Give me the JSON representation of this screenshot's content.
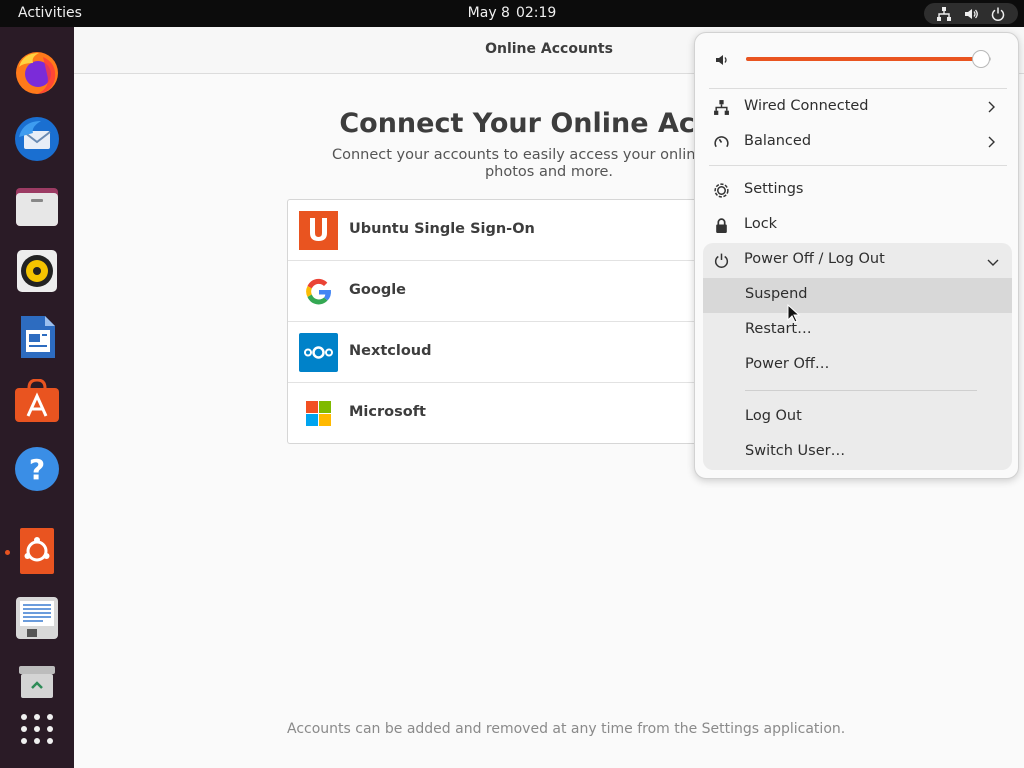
{
  "topbar": {
    "activities": "Activities",
    "date": "May 8",
    "time": "02:19",
    "status_icons": [
      "network-wired-icon",
      "volume-icon",
      "power-icon"
    ]
  },
  "dock": {
    "items": [
      {
        "name": "firefox-icon"
      },
      {
        "name": "thunderbird-icon"
      },
      {
        "name": "files-icon"
      },
      {
        "name": "rhythmbox-icon"
      },
      {
        "name": "libreoffice-writer-icon"
      },
      {
        "name": "ubuntu-software-icon"
      },
      {
        "name": "help-icon"
      },
      {
        "name": "ubuntu-installer-icon",
        "running": true
      },
      {
        "name": "text-editor-icon"
      },
      {
        "name": "trash-icon"
      },
      {
        "name": "show-applications-icon"
      }
    ]
  },
  "window": {
    "title": "Online Accounts",
    "heading": "Connect Your Online Accou",
    "subtitle_line1": "Connect your accounts to easily access your online calenda",
    "subtitle_line2": "photos and more.",
    "providers": [
      {
        "name": "Ubuntu Single Sign-On",
        "icon": "ubuntu-sso-icon"
      },
      {
        "name": "Google",
        "icon": "google-icon"
      },
      {
        "name": "Nextcloud",
        "icon": "nextcloud-icon"
      },
      {
        "name": "Microsoft",
        "icon": "microsoft-icon"
      }
    ],
    "footer": "Accounts can be added and removed at any time from the Settings application."
  },
  "menu": {
    "volume_level": 0.96,
    "items": [
      {
        "label": "Wired Connected",
        "icon": "network-wired-icon",
        "has_arrow": true
      },
      {
        "label": "Balanced",
        "icon": "power-profile-icon",
        "has_arrow": true
      },
      {
        "label": "Settings",
        "icon": "gear-icon"
      },
      {
        "label": "Lock",
        "icon": "lock-icon"
      }
    ],
    "power_submenu": {
      "label": "Power Off / Log Out",
      "items": [
        "Suspend",
        "Restart…",
        "Power Off…"
      ],
      "items2": [
        "Log Out",
        "Switch User…"
      ],
      "hovered": "Suspend"
    }
  },
  "colors": {
    "accent": "#e95420",
    "topbar": "#0c0c0c",
    "dock": "#2a1b26",
    "menu_bg": "#fafafa",
    "submenu_bg": "#ebebeb"
  }
}
